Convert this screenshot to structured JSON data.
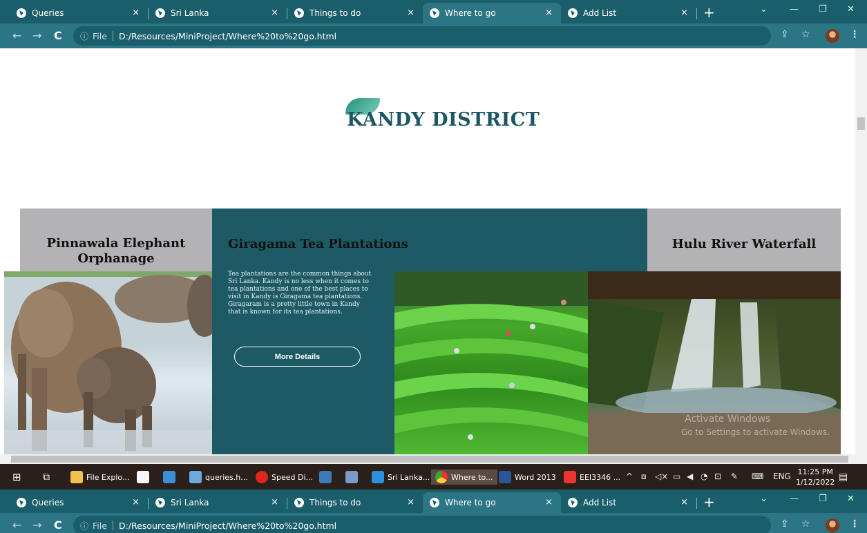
{
  "browser": {
    "tabs": [
      {
        "label": "Queries",
        "active": false
      },
      {
        "label": "Sri Lanka",
        "active": false
      },
      {
        "label": "Things to do",
        "active": false
      },
      {
        "label": "Where to go",
        "active": true
      },
      {
        "label": "Add List",
        "active": false
      }
    ],
    "tab_close": "×",
    "new_tab": "+",
    "url_scheme": "File",
    "url": "D:/Resources/MiniProject/Where%20to%20go.html"
  },
  "page": {
    "heading": "KANDY DISTRICT",
    "cards": [
      {
        "title": "Pinnawala Elephant Orphanage"
      },
      {
        "title": "Giragama Tea Plantations",
        "description": "Tea plantations are the common things about Sri Lanka. Kandy is no less when it comes to tea plantations and one of the best places to visit in Kandy is Giragama tea plantations. Giragaram is a pretty little town in Kandy that is known for its tea plantations.",
        "button": "More Details"
      },
      {
        "title": "Hulu River Waterfall"
      }
    ],
    "watermark_line1": "Activate Windows",
    "watermark_line2": "Go to Settings to activate Windows."
  },
  "taskbar": {
    "items": [
      {
        "label": "File Explo..."
      },
      {
        "label": "queries.h..."
      },
      {
        "label": "Speed Di..."
      },
      {
        "label": "Sri Lanka..."
      },
      {
        "label": "Where to..."
      },
      {
        "label": "Word 2013"
      },
      {
        "label": "EEI3346 ..."
      }
    ],
    "lang": "ENG",
    "time": "11:25 PM",
    "date": "1/12/2022"
  },
  "colors": {
    "theme": "#1e5a65",
    "card_grey": "#b3b3b6",
    "heading": "#1a5663"
  }
}
